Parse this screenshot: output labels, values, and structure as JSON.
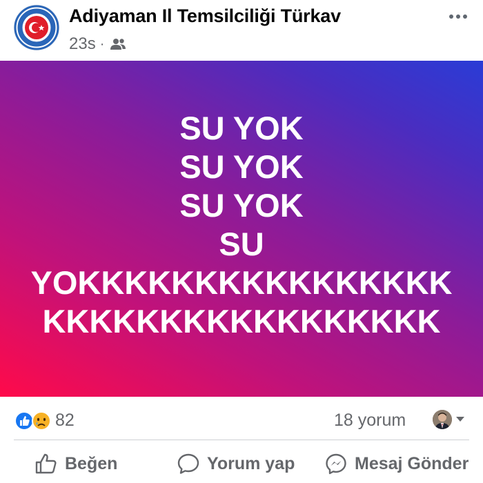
{
  "post": {
    "page_name": "Adiyaman Il Temsilciliği Türkav",
    "timestamp": "23s",
    "separator": "·",
    "audience_icon": "friends-icon",
    "more_icon": "more-horizontal-icon"
  },
  "image": {
    "lines": [
      "SU YOK",
      "SU YOK",
      "SU YOK",
      "SU",
      "YOKKKKKKKKKKKKKKKK",
      "KKKKKKKKKKKKKKKKK"
    ],
    "gradient_colors": [
      "#ff0a4a",
      "#8a1c9a",
      "#2a3cd6"
    ]
  },
  "stats": {
    "reaction_icons": [
      "like-icon",
      "sad-icon"
    ],
    "reaction_count": "82",
    "comment_count": "18 yorum"
  },
  "actions": {
    "like_label": "Beğen",
    "comment_label": "Yorum yap",
    "message_label": "Mesaj Gönder"
  },
  "colors": {
    "text_secondary": "#65676b",
    "like_blue": "#1877f2",
    "text_white": "#ffffff"
  }
}
